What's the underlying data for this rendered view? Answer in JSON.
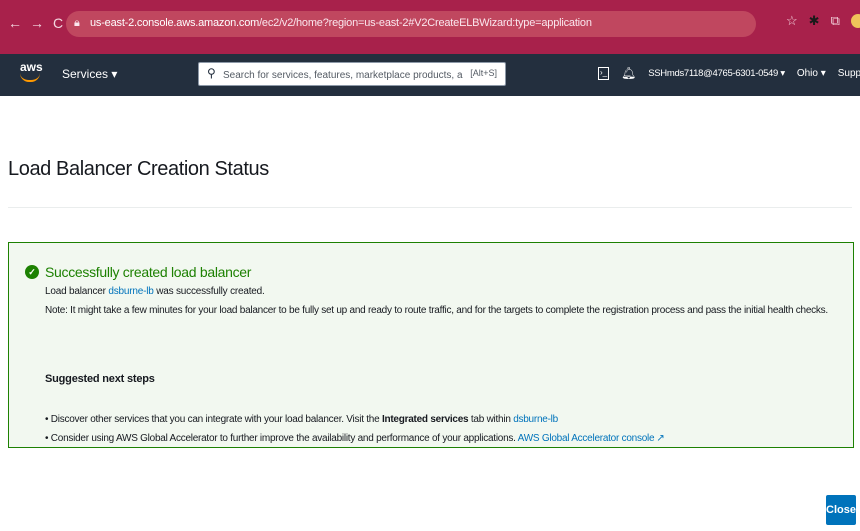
{
  "browser": {
    "url_host": "us-east-2.console.aws.amazon.com",
    "url_path": "/ec2/v2/home?region=us-east-2#V2CreateELBWizard:type=application",
    "icons": [
      "back-icon",
      "forward-icon",
      "reload-icon",
      "lock-icon",
      "bookmark-star-icon",
      "extension-icon",
      "puzzle-icon",
      "profile-icon",
      "menu-dots-icon"
    ]
  },
  "aws_nav": {
    "logo_text": "aws",
    "services_label": "Services ▾",
    "search_placeholder": "Search for services, features, marketplace products, and docs",
    "search_shortcut": "[Alt+S]",
    "account": "SSHmds7118@4765-6301-0549 ▾",
    "region": "Ohio ▾",
    "support": "Support ▾"
  },
  "page": {
    "title": "Load Balancer Creation Status"
  },
  "success": {
    "title": "Successfully created load balancer",
    "lb_prefix": "Load balancer ",
    "lb_name": "dsburne-lb",
    "lb_suffix": " was successfully created.",
    "note": "Note: It might take a few minutes for your load balancer to be fully set up and ready to route traffic, and for the targets to complete the registration process and pass the initial health checks.",
    "next_steps_heading": "Suggested next steps",
    "bullet1_prefix": "• Discover other services that you can integrate with your load balancer. Visit the ",
    "bullet1_bold": "Integrated services",
    "bullet1_middle": " tab within ",
    "bullet1_link": "dsburne-lb",
    "bullet2_prefix": "• Consider using AWS Global Accelerator to further improve the availability and performance of your applications. ",
    "bullet2_link": "AWS Global Accelerator console"
  },
  "actions": {
    "close_label": "Close"
  },
  "colors": {
    "browser_bar": "#a8214b",
    "aws_nav": "#232f3e",
    "success_green": "#1d8102",
    "success_bg": "#f2f8f0",
    "link_blue": "#0073bb",
    "primary_button": "#0073bb"
  }
}
